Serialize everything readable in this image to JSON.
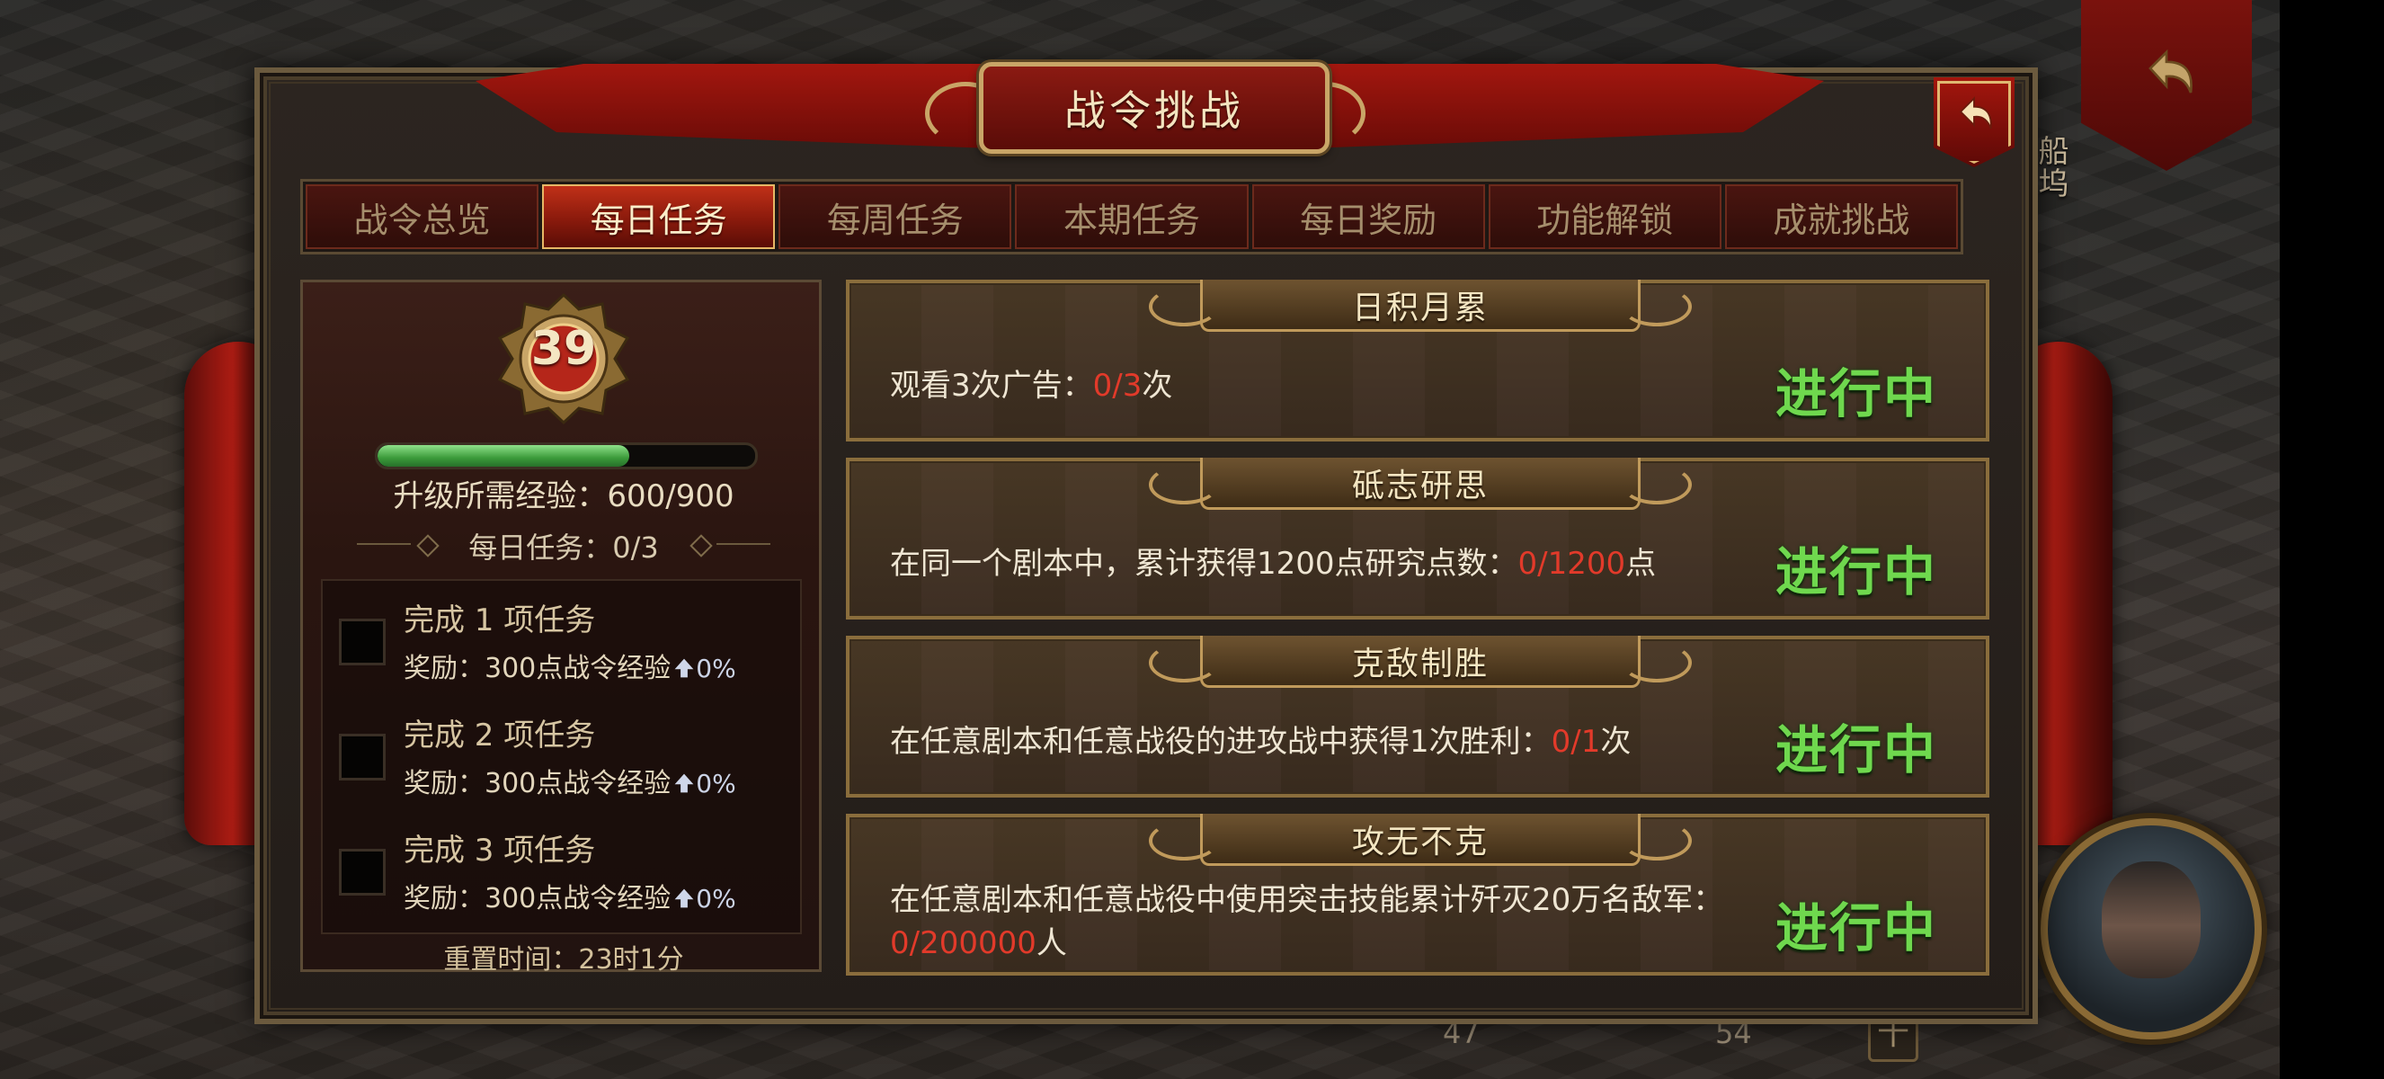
{
  "window": {
    "title": "战令挑战"
  },
  "background": {
    "side_label": "船坞",
    "counter_a": "47",
    "counter_b": "54",
    "plus_label": "十"
  },
  "tabs": [
    {
      "label": "战令总览",
      "active": false
    },
    {
      "label": "每日任务",
      "active": true
    },
    {
      "label": "每周任务",
      "active": false
    },
    {
      "label": "本期任务",
      "active": false
    },
    {
      "label": "每日奖励",
      "active": false
    },
    {
      "label": "功能解锁",
      "active": false
    },
    {
      "label": "成就挑战",
      "active": false
    }
  ],
  "level": {
    "value": "39",
    "exp_progress": 0.667,
    "exp_text": "升级所需经验：600/900",
    "daily_progress": "每日任务：0/3"
  },
  "milestones": [
    {
      "title": "完成 1 项任务",
      "reward": "奖励：300点战令经验",
      "bonus": "0%"
    },
    {
      "title": "完成 2 项任务",
      "reward": "奖励：300点战令经验",
      "bonus": "0%"
    },
    {
      "title": "完成 3 项任务",
      "reward": "奖励：300点战令经验",
      "bonus": "0%"
    }
  ],
  "reset_time": "重置时间：23时1分",
  "tasks": [
    {
      "name": "日积月累",
      "desc_prefix": "观看3次广告：",
      "progress": "0/3",
      "desc_suffix": "次",
      "status": "进行中"
    },
    {
      "name": "砥志研思",
      "desc_prefix": "在同一个剧本中，累计获得1200点研究点数：",
      "progress": "0/1200",
      "desc_suffix": "点",
      "status": "进行中"
    },
    {
      "name": "克敌制胜",
      "desc_prefix": "在任意剧本和任意战役的进攻战中获得1次胜利：",
      "progress": "0/1",
      "desc_suffix": "次",
      "status": "进行中"
    },
    {
      "name": "攻无不克",
      "desc_prefix": "在任意剧本和任意战役中使用突击技能累计歼灭20万名敌军：",
      "progress": "0/200000",
      "desc_suffix": "人",
      "status": "进行中"
    }
  ],
  "colors": {
    "status_green": "#6fd84e",
    "progress_red": "#e23a2a",
    "exp_green": "#3b9a3a",
    "accent_gold": "#c9a567"
  }
}
